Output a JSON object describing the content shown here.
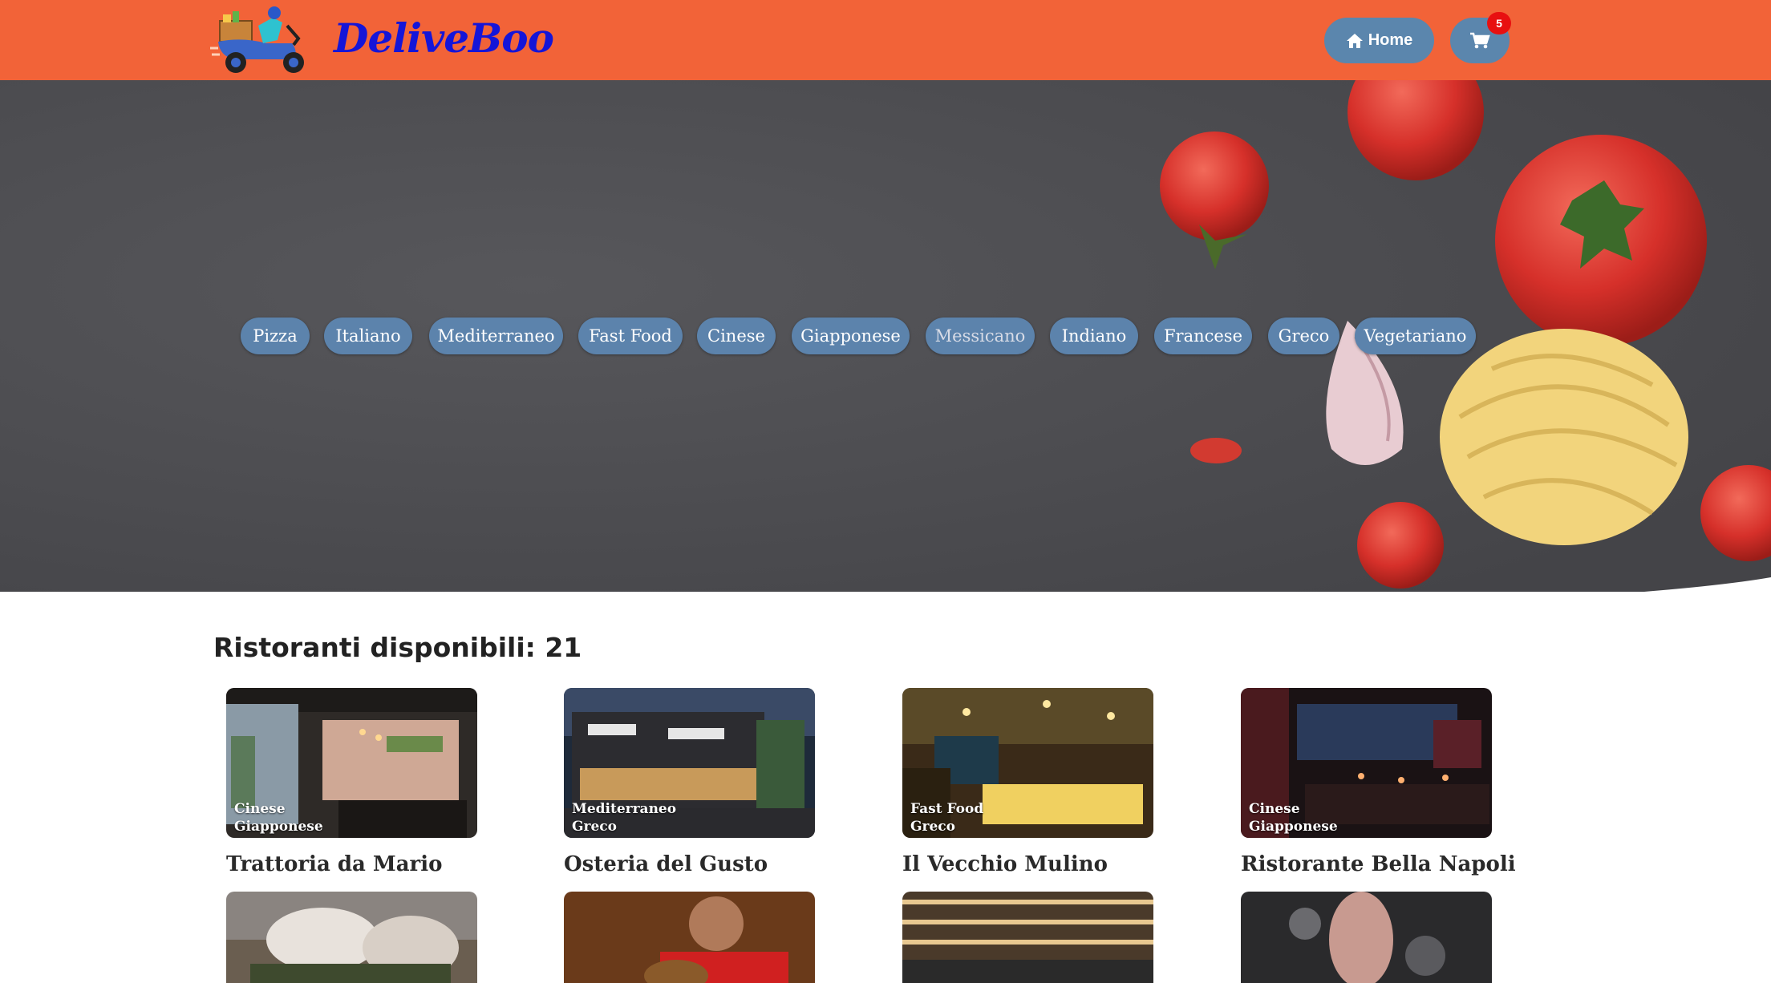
{
  "header": {
    "brand": "DeliveBoo",
    "home_label": "Home",
    "cart_count": "5",
    "colors": {
      "bar": "#f26338",
      "brand": "#1515d8",
      "button": "#5b86ad",
      "badge": "#e81010"
    }
  },
  "hero": {
    "categories": [
      "Pizza",
      "Italiano",
      "Mediterraneo",
      "Fast Food",
      "Cinese",
      "Giapponese",
      "Messicano",
      "Indiano",
      "Francese",
      "Greco",
      "Vegetariano"
    ],
    "active_category": "Messicano"
  },
  "main": {
    "title": "Ristoranti disponibili: 21",
    "restaurants": [
      {
        "name": "Trattoria da Mario",
        "tags": [
          "Cinese",
          "Giapponese"
        ]
      },
      {
        "name": "Osteria del Gusto",
        "tags": [
          "Mediterraneo",
          "Greco"
        ]
      },
      {
        "name": "Il Vecchio Mulino",
        "tags": [
          "Fast Food",
          "Greco"
        ]
      },
      {
        "name": "Ristorante Bella Napoli",
        "tags": [
          "Cinese",
          "Giapponese"
        ]
      }
    ]
  }
}
